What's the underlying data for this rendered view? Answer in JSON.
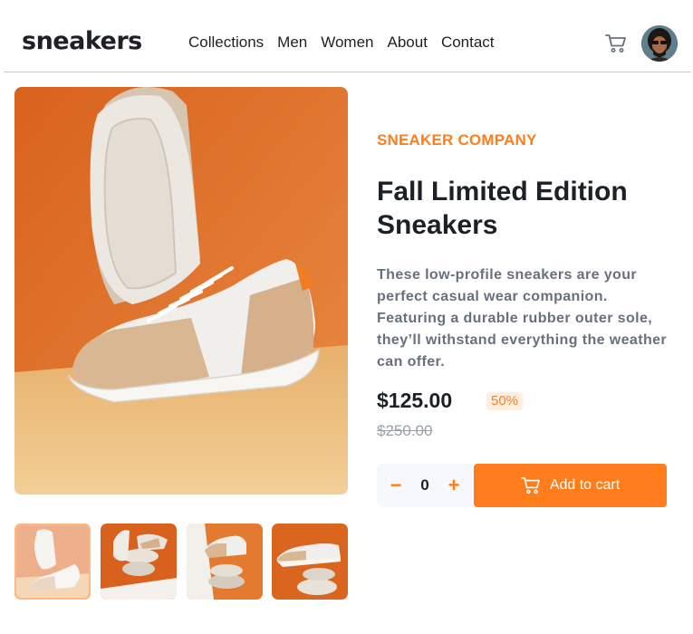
{
  "brand": {
    "logo": "sneakers"
  },
  "nav": {
    "items": [
      "Collections",
      "Men",
      "Women",
      "About",
      "Contact"
    ]
  },
  "header": {
    "cart_icon": "cart-icon",
    "avatar_icon": "avatar"
  },
  "product": {
    "company": "SNEAKER COMPANY",
    "title": "Fall Limited Edition Sneakers",
    "description": "These low-profile sneakers are your perfect casual wear companion. Featuring a durable rubber outer sole, they’ll withstand everything the weather can offer.",
    "price": "$125.00",
    "discount": "50%",
    "original_price": "$250.00"
  },
  "cart": {
    "quantity": "0",
    "minus_label": "−",
    "plus_label": "+",
    "add_label": "Add to cart"
  },
  "gallery": {
    "thumbnails": [
      "product-thumbnail-1",
      "product-thumbnail-2",
      "product-thumbnail-3",
      "product-thumbnail-4"
    ],
    "active_index": 0
  },
  "colors": {
    "accent": "#ff7e1b",
    "accent_pale": "#ffede0",
    "text_dark": "#1d2026",
    "text_gray": "#68707d",
    "background_orange": "#e0702e",
    "floor_tan": "#e8b878"
  }
}
